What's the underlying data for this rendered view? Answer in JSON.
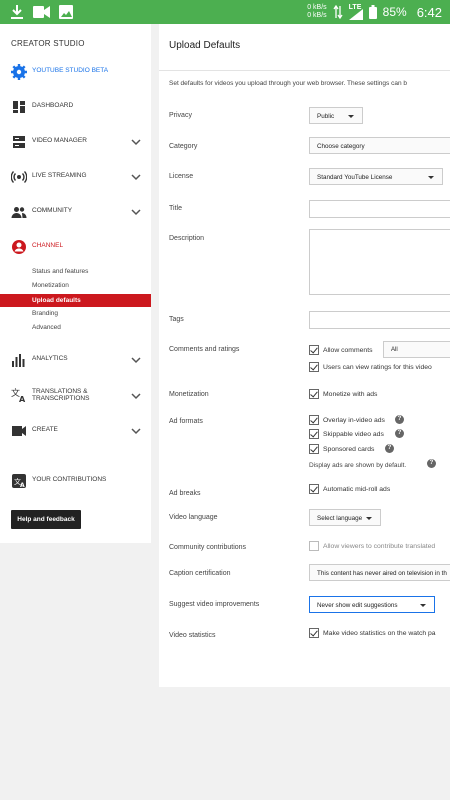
{
  "status_bar": {
    "net_up": "0 kB/s",
    "net_down": "0 kB/s",
    "network": "LTE",
    "battery": "85%",
    "time": "6:42",
    "icons": [
      "download-icon",
      "video-camera-icon",
      "image-icon",
      "wifi-arrows-icon",
      "signal-icon",
      "battery-icon"
    ]
  },
  "sidebar": {
    "title": "CREATOR STUDIO",
    "items": [
      {
        "label": "YOUTUBE STUDIO BETA",
        "icon": "gear-icon"
      },
      {
        "label": "DASHBOARD",
        "icon": "dashboard-icon"
      },
      {
        "label": "VIDEO MANAGER",
        "icon": "video-manager-icon"
      },
      {
        "label": "LIVE STREAMING",
        "icon": "live-streaming-icon"
      },
      {
        "label": "COMMUNITY",
        "icon": "community-icon"
      },
      {
        "label": "CHANNEL",
        "icon": "channel-icon"
      },
      {
        "label": "ANALYTICS",
        "icon": "analytics-icon"
      },
      {
        "label": "TRANSLATIONS &",
        "label2": "TRANSCRIPTIONS",
        "icon": "translate-icon"
      },
      {
        "label": "CREATE",
        "icon": "create-icon"
      },
      {
        "label": "YOUR CONTRIBUTIONS",
        "icon": "contributions-icon"
      }
    ],
    "channel_sub": [
      "Status and features",
      "Monetization",
      "Upload defaults",
      "Branding",
      "Advanced"
    ],
    "help_button": "Help and feedback"
  },
  "main": {
    "title": "Upload Defaults",
    "intro": "Set defaults for videos you upload through your web browser. These settings can b",
    "labels": {
      "privacy": "Privacy",
      "category": "Category",
      "license": "License",
      "title": "Title",
      "description": "Description",
      "tags": "Tags",
      "comments": "Comments and ratings",
      "monetization": "Monetization",
      "ad_formats": "Ad formats",
      "ad_breaks": "Ad breaks",
      "video_language": "Video language",
      "community_contributions": "Community contributions",
      "caption_certification": "Caption certification",
      "suggest_improvements": "Suggest video improvements",
      "video_statistics": "Video statistics"
    },
    "values": {
      "privacy": "Public",
      "category": "Choose category",
      "license": "Standard YouTube License",
      "comments_filter": "All",
      "video_language": "Select language",
      "caption_certification": "This content has never aired on television in th",
      "suggest_improvements": "Never show edit suggestions"
    },
    "checks": {
      "allow_comments": {
        "label": "Allow comments",
        "checked": true
      },
      "view_ratings": {
        "label": "Users can view ratings for this video",
        "checked": true
      },
      "monetize": {
        "label": "Monetize with ads",
        "checked": true
      },
      "overlay": {
        "label": "Overlay in-video ads",
        "checked": true
      },
      "skippable": {
        "label": "Skippable video ads",
        "checked": true
      },
      "sponsored": {
        "label": "Sponsored cards",
        "checked": true
      },
      "midroll": {
        "label": "Automatic mid-roll ads",
        "checked": true
      },
      "contribute": {
        "label": "Allow viewers to contribute translated",
        "checked": false
      },
      "statistics": {
        "label": "Make video statistics on the watch pa",
        "checked": true
      }
    },
    "display_ads_note": "Display ads are shown by default.",
    "help_glyph": "?"
  },
  "colors": {
    "status_bar": "#4caf50",
    "accent_red": "#cc181e",
    "beta_blue": "#1a73e8"
  }
}
